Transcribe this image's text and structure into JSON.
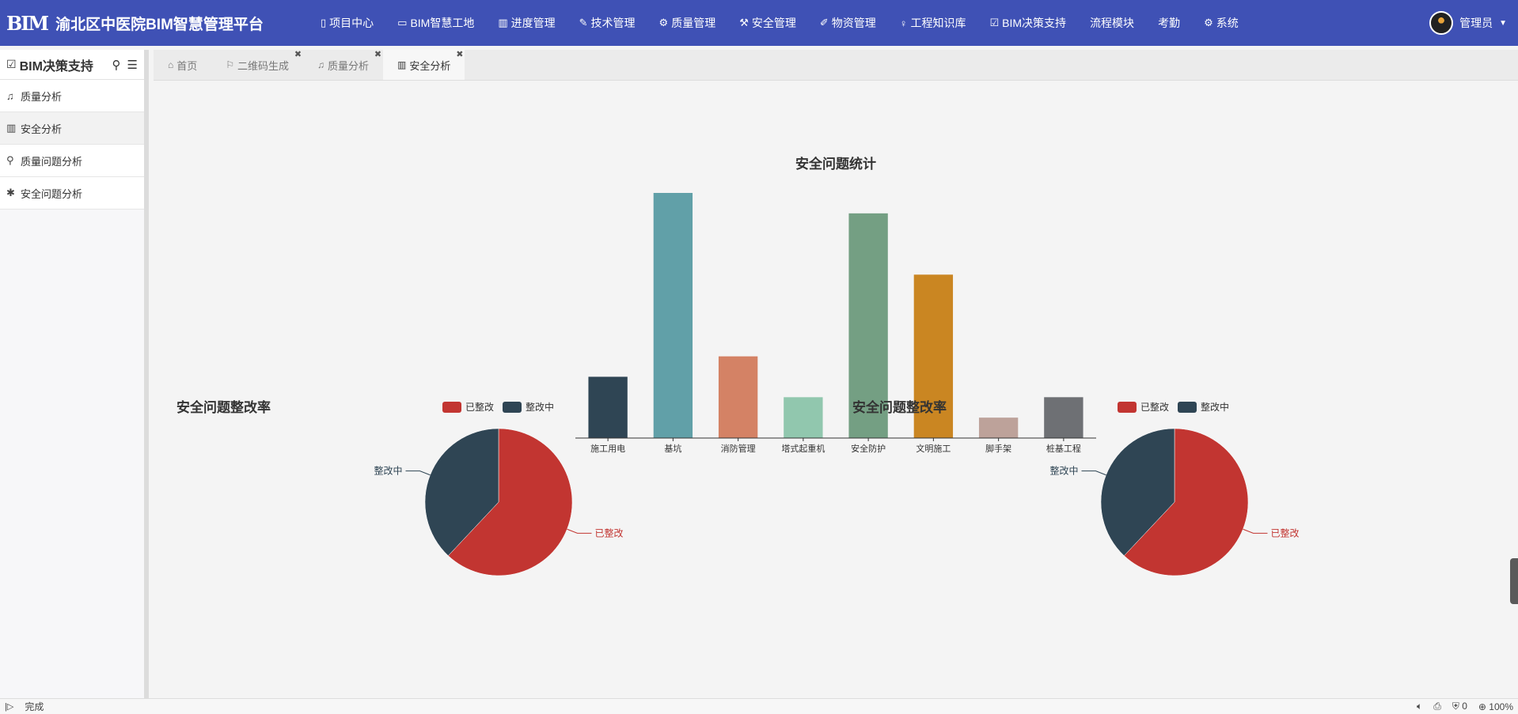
{
  "app": {
    "logo": "BIM",
    "title": "渝北区中医院BIM智慧管理平台"
  },
  "nav": [
    {
      "icon": "document-icon",
      "glyph": "▯",
      "label": "项目中心"
    },
    {
      "icon": "card-icon",
      "glyph": "▭",
      "label": "BIM智慧工地"
    },
    {
      "icon": "bar-chart-icon",
      "glyph": "▥",
      "label": "进度管理"
    },
    {
      "icon": "pencil-icon",
      "glyph": "✎",
      "label": "技术管理"
    },
    {
      "icon": "gears-icon",
      "glyph": "⚙",
      "label": "质量管理"
    },
    {
      "icon": "wrench-icon",
      "glyph": "⚒",
      "label": "安全管理"
    },
    {
      "icon": "edit-icon",
      "glyph": "✐",
      "label": "物资管理"
    },
    {
      "icon": "lightbulb-icon",
      "glyph": "♀",
      "label": "工程知识库"
    },
    {
      "icon": "check-square-icon",
      "glyph": "☑",
      "label": "BIM决策支持"
    },
    {
      "icon": "",
      "glyph": "",
      "label": "流程模块"
    },
    {
      "icon": "",
      "glyph": "",
      "label": "考勤"
    },
    {
      "icon": "gear-icon",
      "glyph": "⚙",
      "label": "系统"
    }
  ],
  "user": {
    "name": "管理员"
  },
  "sidebar": {
    "title": "BIM决策支持",
    "items": [
      {
        "icon": "bell-icon",
        "glyph": "♫",
        "label": "质量分析"
      },
      {
        "icon": "bar-chart-icon",
        "glyph": "▥",
        "label": "安全分析"
      },
      {
        "icon": "search-icon",
        "glyph": "⚲",
        "label": "质量问题分析"
      },
      {
        "icon": "asterisk-icon",
        "glyph": "✱",
        "label": "安全问题分析"
      }
    ]
  },
  "tabs": [
    {
      "icon": "home-icon",
      "glyph": "⌂",
      "label": "首页",
      "closable": false
    },
    {
      "icon": "bookmark-icon",
      "glyph": "⚐",
      "label": "二维码生成",
      "closable": true
    },
    {
      "icon": "bell-icon",
      "glyph": "♫",
      "label": "质量分析",
      "closable": true
    },
    {
      "icon": "bar-chart-icon",
      "glyph": "▥",
      "label": "安全分析",
      "closable": true
    }
  ],
  "status": {
    "text": "完成",
    "shield_count": "0",
    "zoom": "100%"
  },
  "colors": {
    "topbar": "#3f51b5",
    "bars": [
      "#2f4554",
      "#61a0a8",
      "#d48265",
      "#91c7ae",
      "#749f83",
      "#ca8622",
      "#bda29a",
      "#6e7074"
    ],
    "rectified": "#c23531",
    "in_progress": "#2f4554"
  },
  "chart_data": [
    {
      "type": "bar",
      "title": "安全问题统计",
      "categories": [
        "施工用电",
        "基坑",
        "消防管理",
        "塔式起重机",
        "安全防护",
        "文明施工",
        "脚手架",
        "桩基工程"
      ],
      "values": [
        3,
        12,
        4,
        2,
        11,
        8,
        1,
        2
      ],
      "ylim": [
        0,
        12
      ],
      "grid": false
    },
    {
      "type": "pie",
      "title": "安全问题整改率",
      "legend": [
        "已整改",
        "整改中"
      ],
      "legend_position": "top",
      "slices": [
        {
          "label": "已整改",
          "value": 62
        },
        {
          "label": "整改中",
          "value": 38
        }
      ]
    },
    {
      "type": "pie",
      "title": "安全问题整改率",
      "legend": [
        "已整改",
        "整改中"
      ],
      "legend_position": "top",
      "slices": [
        {
          "label": "已整改",
          "value": 62
        },
        {
          "label": "整改中",
          "value": 38
        }
      ]
    }
  ]
}
